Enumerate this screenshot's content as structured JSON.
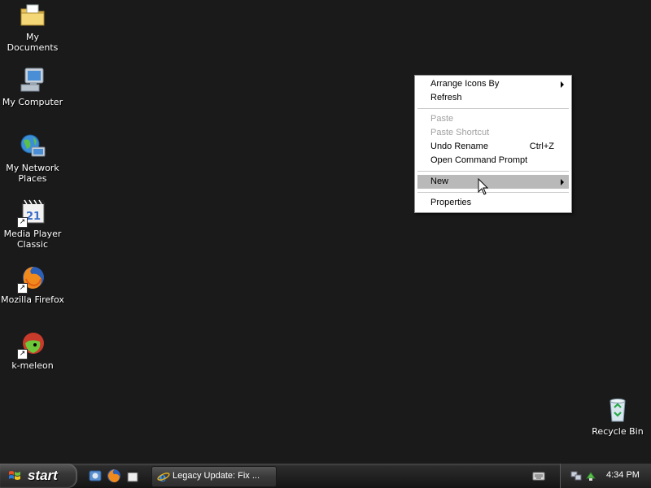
{
  "desktop": {
    "icons": [
      {
        "label": "My Documents",
        "icon": "folder-documents-icon"
      },
      {
        "label": "My Computer",
        "icon": "computer-icon"
      },
      {
        "label": "My Network Places",
        "icon": "network-globe-icon"
      },
      {
        "label": "Media Player Classic",
        "icon": "media-player-icon"
      },
      {
        "label": "Mozilla Firefox",
        "icon": "firefox-icon"
      },
      {
        "label": "k-meleon",
        "icon": "k-meleon-icon"
      },
      {
        "label": "Recycle Bin",
        "icon": "recycle-bin-icon"
      }
    ]
  },
  "context_menu": {
    "items": [
      {
        "label": "Arrange Icons By",
        "submenu": true
      },
      {
        "label": "Refresh"
      },
      {
        "label": "Paste",
        "disabled": true
      },
      {
        "label": "Paste Shortcut",
        "disabled": true
      },
      {
        "label": "Undo Rename",
        "shortcut": "Ctrl+Z"
      },
      {
        "label": "Open Command Prompt"
      },
      {
        "label": "New",
        "submenu": true,
        "highlighted": true
      },
      {
        "label": "Properties"
      }
    ]
  },
  "taskbar": {
    "start_label": "start",
    "quick_launch": [
      "control-panel-icon",
      "firefox-icon",
      "media-player-icon"
    ],
    "tasks": [
      {
        "label": "Legacy Update: Fix ...",
        "icon": "internet-explorer-icon"
      }
    ],
    "tray_icons": [
      "network-icon",
      "safely-remove-icon"
    ],
    "clock": "4:34 PM"
  },
  "colors": {
    "desktop_bg": "#1a1a1a",
    "menu_highlight": "#b9b9b9",
    "menu_disabled": "#a0a0a0"
  }
}
